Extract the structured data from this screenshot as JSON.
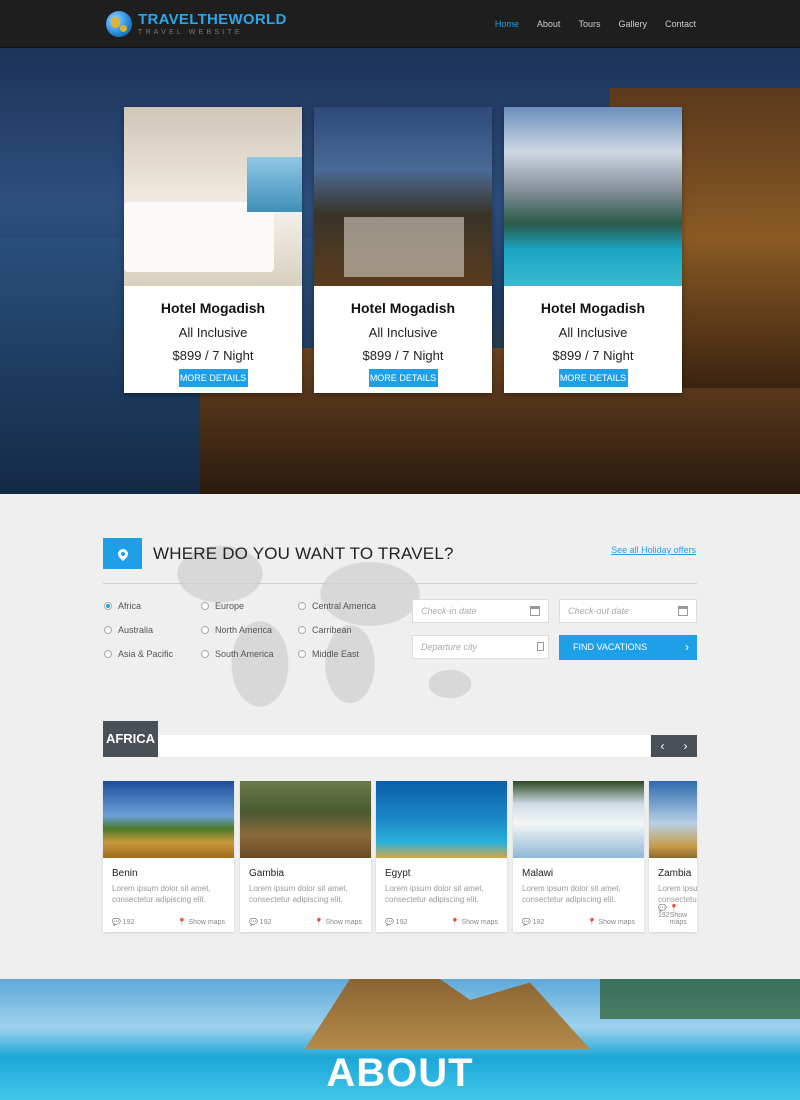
{
  "nav": {
    "logo_main": "TRAVELTHEWORLD",
    "logo_sub": "TRAVEL WEBSITE",
    "items": [
      "Home",
      "About",
      "Tours",
      "Gallery",
      "Contact"
    ],
    "active": "Home"
  },
  "hero": {
    "cards": [
      {
        "title": "Hotel Mogadish",
        "subtitle": "All Inclusive",
        "price": "$899 / 7 Night",
        "button": "MORE DETAILS"
      },
      {
        "title": "Hotel Mogadish",
        "subtitle": "All Inclusive",
        "price": "$899 / 7 Night",
        "button": "MORE DETAILS"
      },
      {
        "title": "Hotel Mogadish",
        "subtitle": "All Inclusive",
        "price": "$899 / 7 Night",
        "button": "MORE DETAILS"
      }
    ]
  },
  "search": {
    "title": "WHERE DO YOU WANT TO TRAVEL?",
    "link": "See all Holiday offers",
    "regions": [
      "Africa",
      "Europe",
      "Central America",
      "Australia",
      "North America",
      "Carribean",
      "Asia & Pacific",
      "South America",
      "Middle East"
    ],
    "selected_region": "Africa",
    "checkin_placeholder": "Check-in date",
    "checkout_placeholder": "Check-out date",
    "departure_placeholder": "Departure city",
    "find_button": "FIND VACATIONS",
    "accent_color": "#1ea0e8"
  },
  "africa": {
    "label": "AFRICA",
    "prev": "‹",
    "next": "›",
    "destinations": [
      {
        "name": "Benin",
        "desc": "Lorem ipsum dolor sit amet, consectetur adipiscing elit.",
        "comments": "192",
        "map": "Show maps"
      },
      {
        "name": "Gambia",
        "desc": "Lorem ipsum dolor sit amet, consectetur adipiscing elit.",
        "comments": "192",
        "map": "Show maps"
      },
      {
        "name": "Egypt",
        "desc": "Lorem ipsum dolor sit amet, consectetur adipiscing elit.",
        "comments": "192",
        "map": "Show maps"
      },
      {
        "name": "Malawi",
        "desc": "Lorem ipsum dolor sit amet, consectetur adipiscing elit.",
        "comments": "192",
        "map": "Show maps"
      },
      {
        "name": "Zambia",
        "desc": "Lorem ipsum dolor sit amet, consectetur adipiscing elit.",
        "comments": "192",
        "map": "Show maps"
      }
    ]
  },
  "about": {
    "heading": "ABOUT"
  }
}
